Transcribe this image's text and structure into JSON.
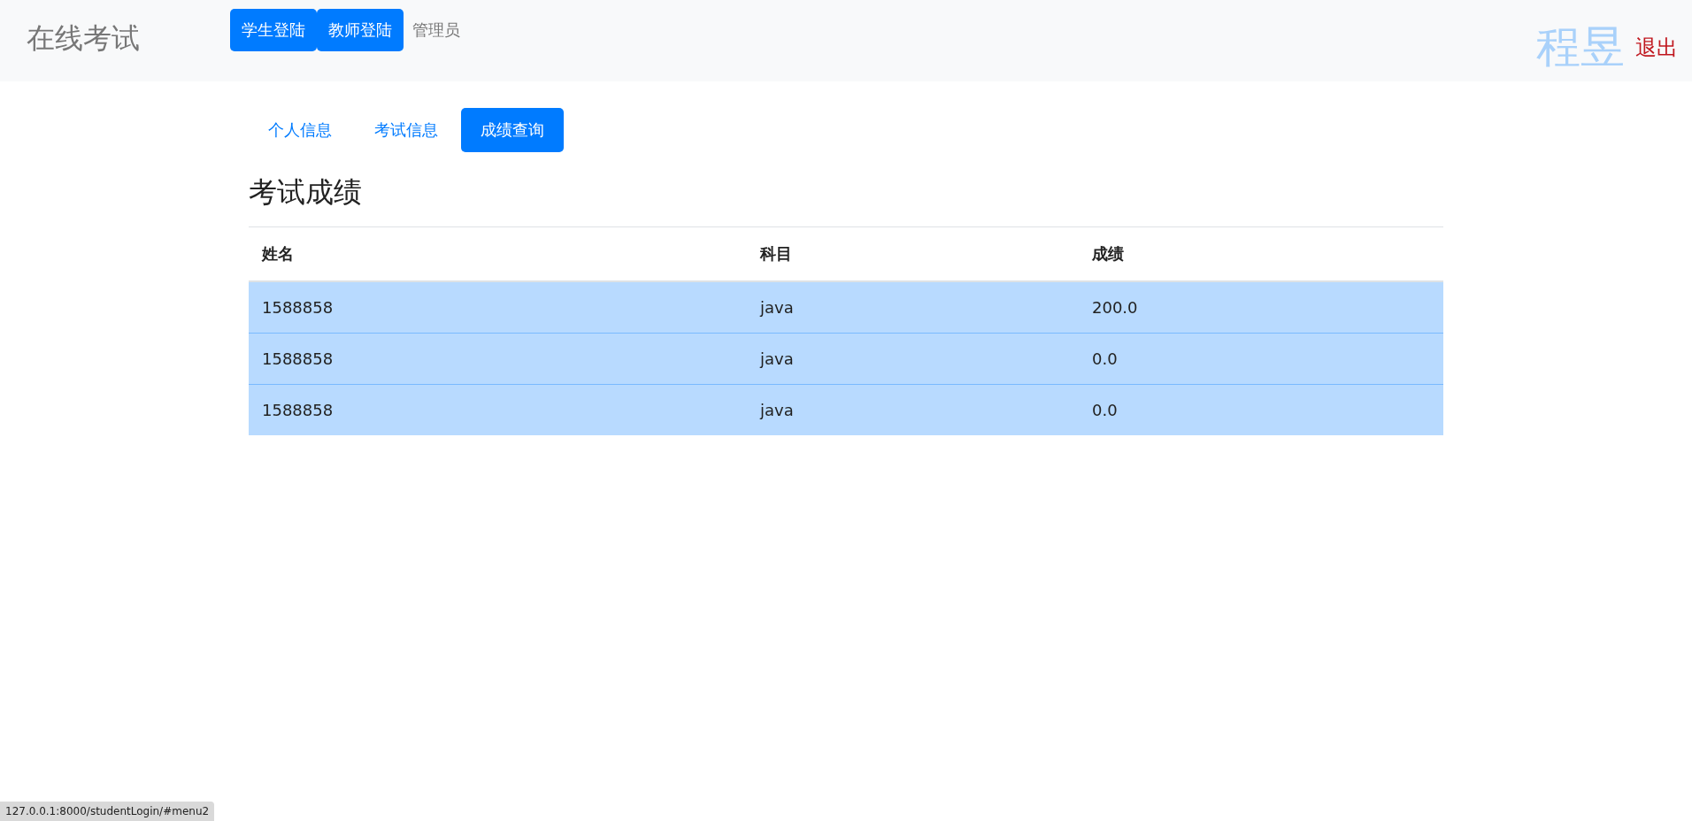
{
  "navbar": {
    "brand": "在线考试",
    "links": [
      {
        "label": "学生登陆",
        "kind": "button"
      },
      {
        "label": "教师登陆",
        "kind": "button"
      },
      {
        "label": "管理员",
        "kind": "link"
      }
    ],
    "user_name": "程昱",
    "logout": "退出"
  },
  "tabs": [
    {
      "label": "个人信息",
      "selected": false
    },
    {
      "label": "考试信息",
      "selected": false
    },
    {
      "label": "成绩查询",
      "selected": true
    }
  ],
  "heading": "考试成绩",
  "table": {
    "columns": [
      "姓名",
      "科目",
      "成绩"
    ],
    "rows": [
      [
        "1588858",
        "java",
        "200.0"
      ],
      [
        "1588858",
        "java",
        "0.0"
      ],
      [
        "1588858",
        "java",
        "0.0"
      ]
    ]
  },
  "status_bar": "127.0.0.1:8000/studentLogin/#menu2"
}
